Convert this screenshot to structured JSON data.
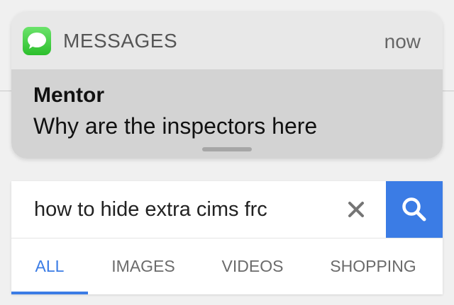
{
  "notification": {
    "app_name": "MESSAGES",
    "time": "now",
    "sender": "Mentor",
    "message": "Why are the inspectors here",
    "app_icon": "messages-bubble-icon"
  },
  "search": {
    "query": "how to hide extra cims frc",
    "clear_icon": "close-icon",
    "search_icon": "search-icon"
  },
  "tabs": [
    {
      "label": "ALL",
      "active": true
    },
    {
      "label": "IMAGES",
      "active": false
    },
    {
      "label": "VIDEOS",
      "active": false
    },
    {
      "label": "SHOPPING",
      "active": false
    }
  ],
  "colors": {
    "accent": "#3b7ce5",
    "messages_green": "#2cbf2c"
  }
}
